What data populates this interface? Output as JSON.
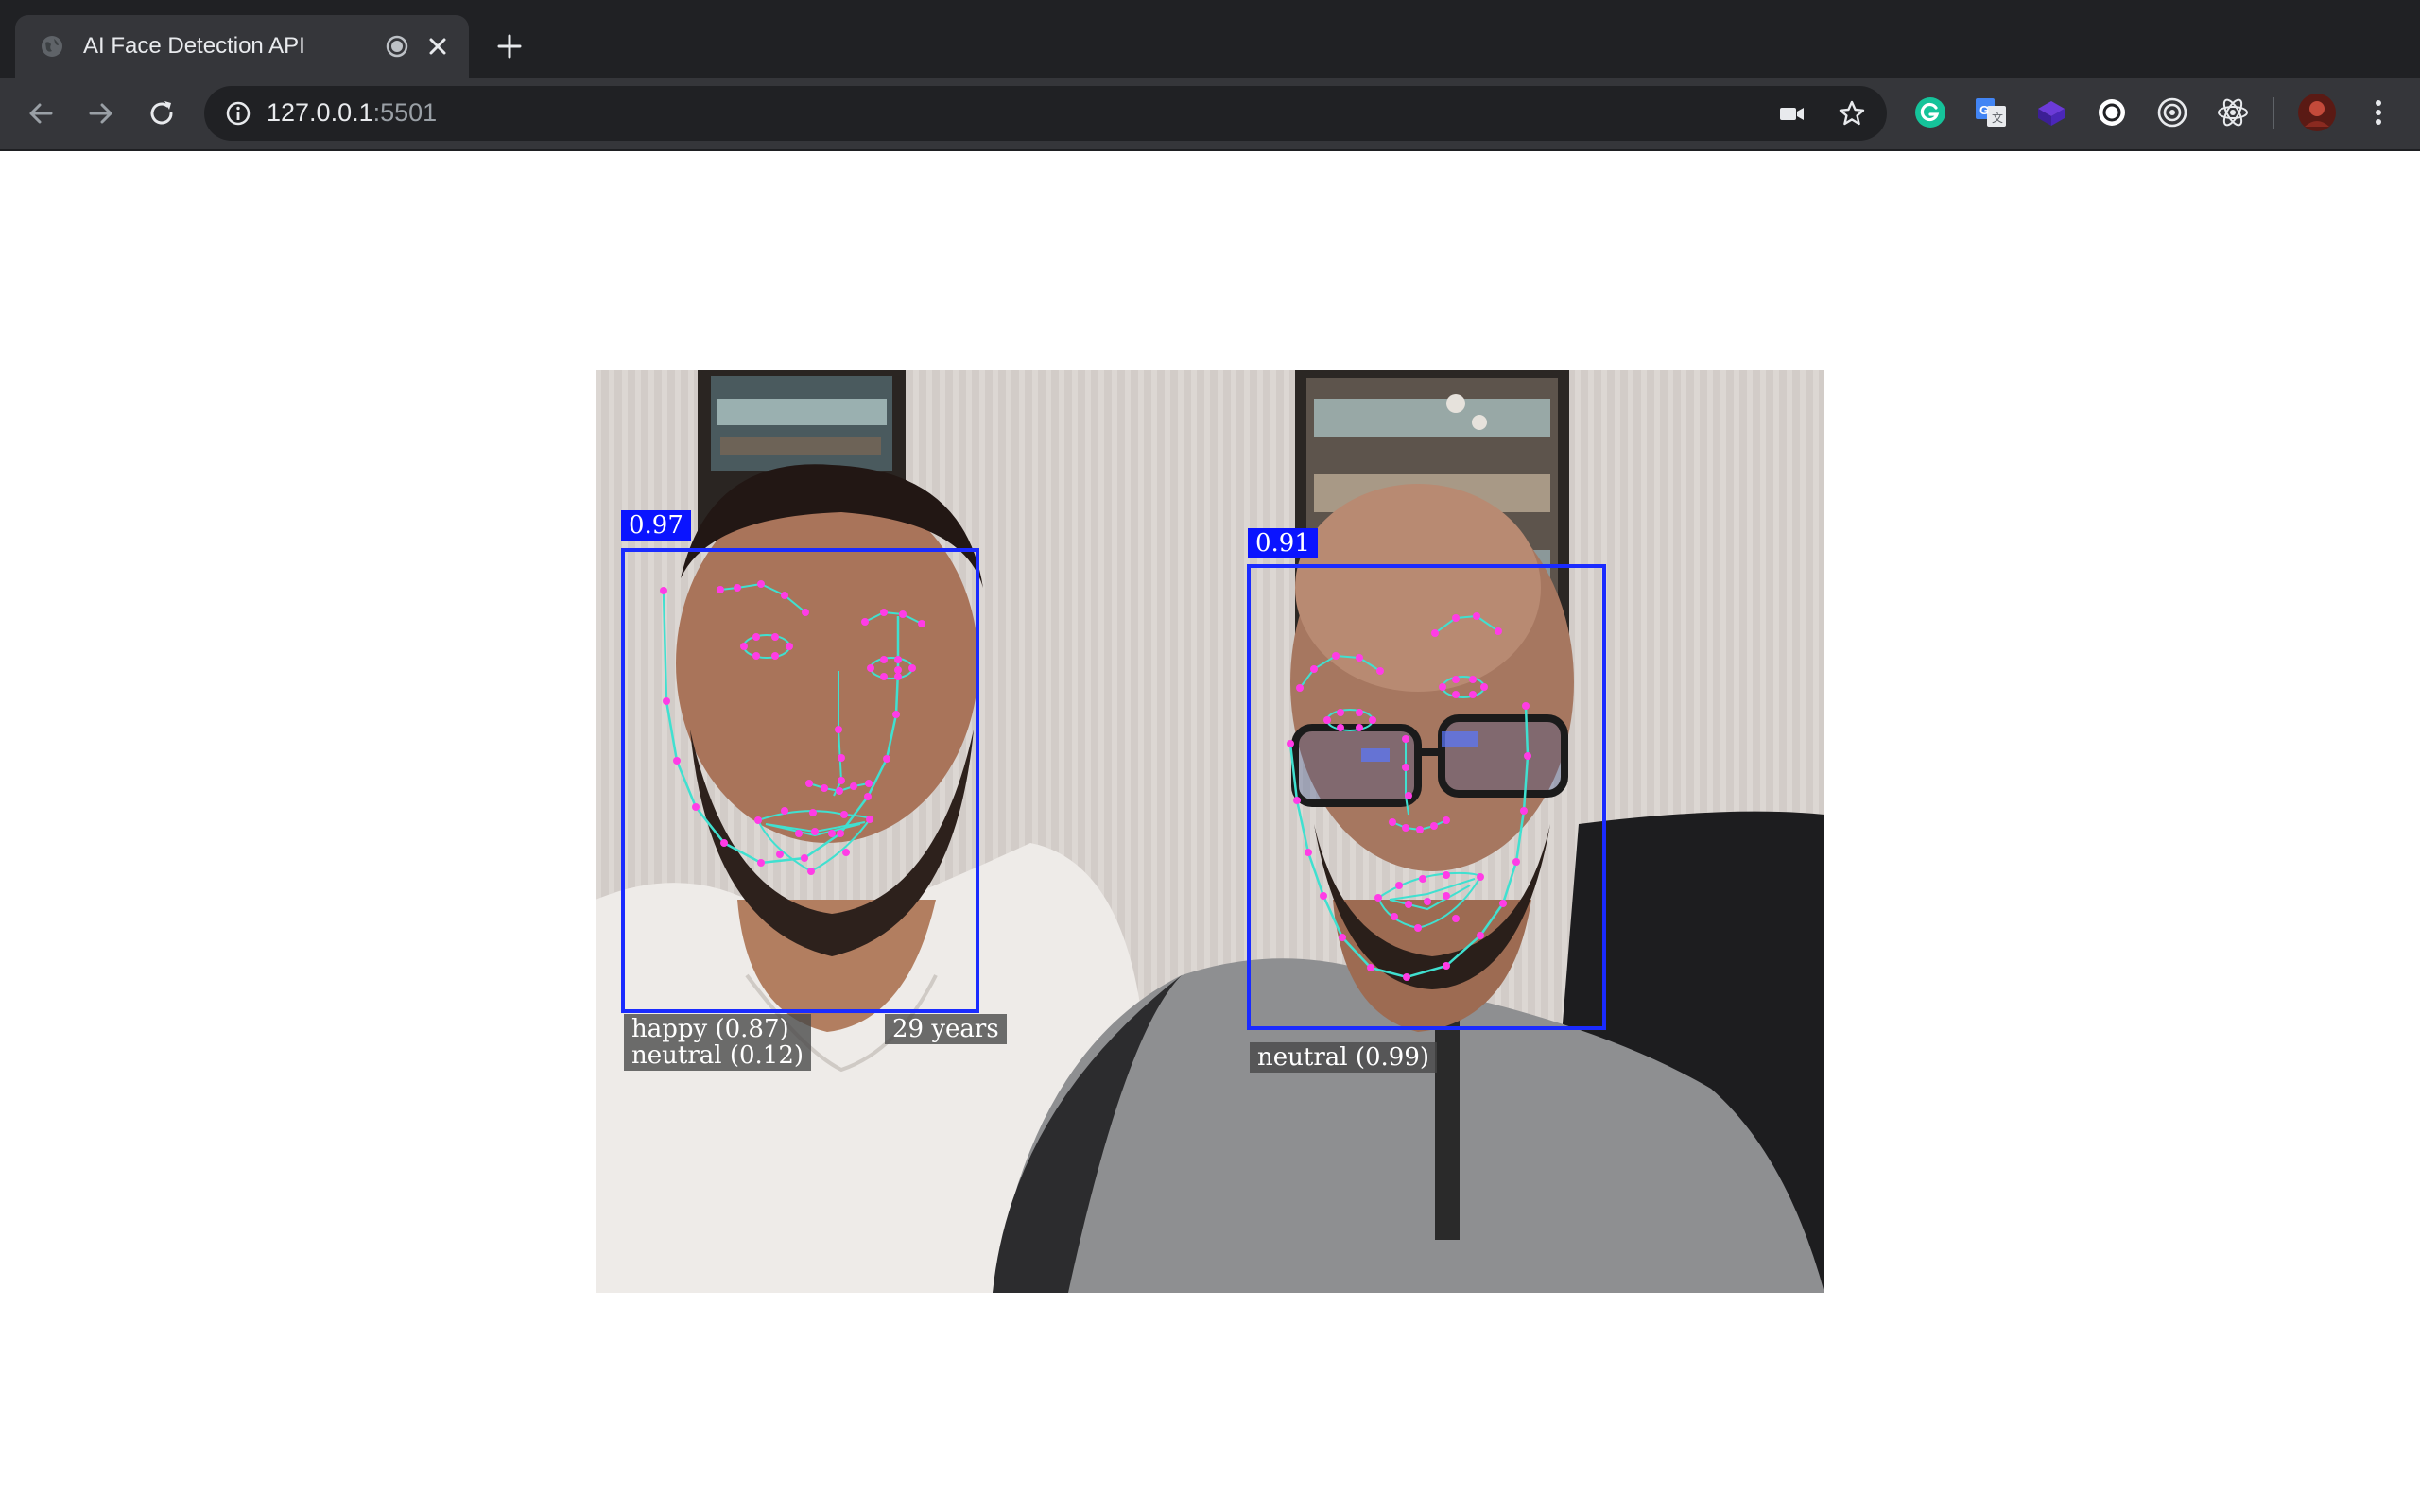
{
  "browser": {
    "tab": {
      "title": "AI Face Detection API"
    },
    "address": {
      "host": "127.0.0.1",
      "port": ":5501"
    }
  },
  "detections": [
    {
      "score": "0.97",
      "expressions": [
        "happy (0.87)",
        "neutral (0.12)"
      ],
      "age": "29 years"
    },
    {
      "score": "0.91",
      "expressions": [
        "neutral (0.99)"
      ]
    }
  ],
  "colors": {
    "box": "#1a2bff",
    "jawline": "#40e0d0",
    "landmark": "#ff3ce6"
  },
  "icons": [
    "globe-icon",
    "audio-recording-icon",
    "close-icon",
    "plus-icon",
    "back-arrow-icon",
    "forward-arrow-icon",
    "reload-icon",
    "info-icon",
    "camera-icon",
    "star-icon",
    "grammarly-icon",
    "google-translate-icon",
    "extension-cube-icon",
    "extension-circle-icon",
    "target-icon",
    "react-devtools-icon",
    "profile-avatar-icon",
    "kebab-menu-icon"
  ]
}
